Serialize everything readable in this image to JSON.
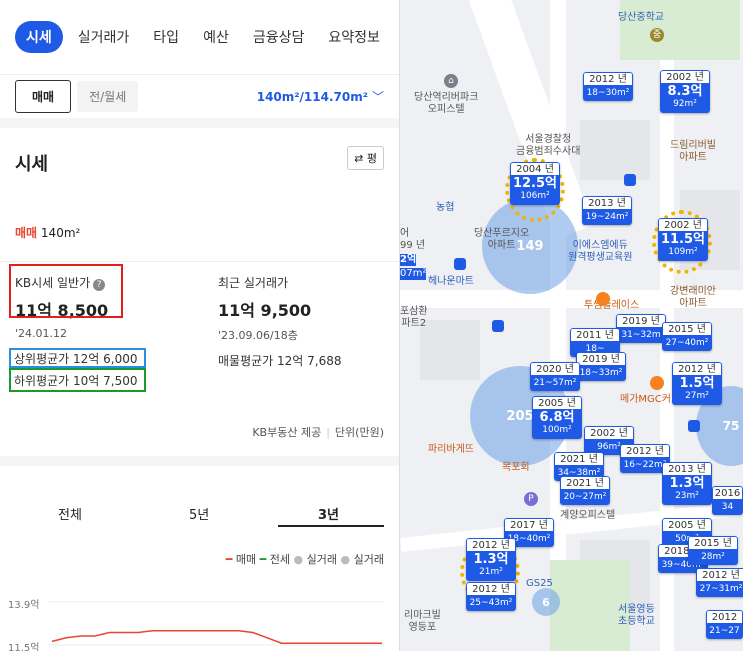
{
  "tabs": [
    {
      "label": "시세",
      "active": true
    },
    {
      "label": "실거래가"
    },
    {
      "label": "타입"
    },
    {
      "label": "예산"
    },
    {
      "label": "금융상담"
    },
    {
      "label": "요약정보"
    }
  ],
  "subbar": {
    "sale_label": "매매",
    "rent_label": "전/월세",
    "area_selector": "140m²/114.70m²"
  },
  "section": {
    "title": "시세",
    "pyeong_button": "평"
  },
  "deal": {
    "type": "매매",
    "area": "140m²"
  },
  "kb": {
    "label": "KB시세 일반가",
    "value": "11억 8,500",
    "date": "'24.01.12",
    "upper_avg": "상위평균가 12억 6,000",
    "lower_avg": "하위평균가 10억 7,500"
  },
  "recent": {
    "label": "최근 실거래가",
    "value": "11억 9,500",
    "date": "'23.09.06/18층",
    "listing_avg": "매물평균가 12억 7,688"
  },
  "provider": {
    "source": "KB부동산 제공",
    "unit": "단위(만원)"
  },
  "range_tabs": [
    {
      "label": "전체"
    },
    {
      "label": "5년"
    },
    {
      "label": "3년",
      "active": true
    }
  ],
  "legend": {
    "sale": "매매",
    "jeonse": "전세",
    "actual1": "실거래",
    "actual2": "실거래"
  },
  "chart_data": {
    "type": "line",
    "yticks": [
      "13.9억",
      "11.5억"
    ],
    "series": [
      {
        "name": "매매",
        "color": "#e6462d",
        "values": [
          11.7,
          11.9,
          12.0,
          12.0,
          12.2,
          12.2,
          12.2,
          12.3,
          12.3,
          12.3,
          12.3,
          12.3,
          12.3,
          12.3,
          12.2,
          11.9,
          11.6,
          11.6,
          11.6,
          11.6,
          11.6,
          11.6,
          11.6,
          11.6
        ]
      }
    ]
  },
  "map": {
    "places": [
      {
        "name": "당산중학교"
      },
      {
        "name": "당산역리버파크\n오피스텔"
      },
      {
        "name": "서울경찰청\n금융범죄수사대"
      },
      {
        "name": "드림리버빌\n아파트"
      },
      {
        "name": "농협"
      },
      {
        "name": "당산푸르지오\n아파트"
      },
      {
        "name": "이에스엠에듀\n원격평생교육원"
      },
      {
        "name": "강변래미안\n아파트"
      },
      {
        "name": "투썸플레이스"
      },
      {
        "name": "헤나운마트"
      },
      {
        "name": "메가MGC커"
      },
      {
        "name": "파리바게뜨"
      },
      {
        "name": "목포회"
      },
      {
        "name": "계양오피스텔"
      },
      {
        "name": "서울영등\n초등학교"
      },
      {
        "name": "리마크빌\n영등포"
      },
      {
        "name": "GS25"
      }
    ],
    "markers": [
      {
        "year": "2012 년",
        "line": "18~30m²"
      },
      {
        "year": "2002 년",
        "price": "8.3억",
        "line": "92m²"
      },
      {
        "year": "2004 년",
        "price": "12.5억",
        "line": "106m²"
      },
      {
        "year": "2013 년",
        "line": "19~24m²"
      },
      {
        "year": "2002 년",
        "price": "11.5억",
        "line": "109m²"
      },
      {
        "year": "2019 년",
        "line": "31~32m"
      },
      {
        "year": "2015 년",
        "line": "27~40m²"
      },
      {
        "year": "2011 년",
        "line": "18~"
      },
      {
        "year": "2019 년",
        "line": "18~33m²"
      },
      {
        "year": "2020 년",
        "line": "21~57m²"
      },
      {
        "year": "2012 년",
        "price": "1.5억",
        "line": "27m²"
      },
      {
        "year": "2005 년",
        "price": "6.8억",
        "line": "100m²"
      },
      {
        "year": "2002 년",
        "line": "96m²"
      },
      {
        "year": "2012 년",
        "line": "16~22m²"
      },
      {
        "year": "2021 년",
        "line": "34~38m²"
      },
      {
        "year": "2013 년",
        "price": "1.3억",
        "line": "23m²"
      },
      {
        "year": "2021 년",
        "line": "20~27m²"
      },
      {
        "year": "2005 년",
        "line": "50m²"
      },
      {
        "year": "2017 년",
        "line": "18~40m²"
      },
      {
        "year": "2012 년",
        "price": "1.3억",
        "line": "21m²"
      },
      {
        "year": "2018 년",
        "line": "39~40m²"
      },
      {
        "year": "2015 년",
        "line": "28m²"
      },
      {
        "year": "2012 년",
        "line": "27~31m²"
      },
      {
        "year": "2012 년",
        "line": "25~43m²"
      },
      {
        "year": "2016",
        "line": "34"
      },
      {
        "year": "2012",
        "line": "21~27"
      }
    ],
    "clusters": [
      {
        "count": "149"
      },
      {
        "count": "205"
      },
      {
        "count": "75"
      },
      {
        "count": "6"
      }
    ],
    "edge_labels": [
      {
        "text": "어"
      },
      {
        "text": "99 년"
      },
      {
        "text": "2억"
      },
      {
        "text": "07m²"
      },
      {
        "text": "포삼환\n파트2"
      }
    ]
  }
}
